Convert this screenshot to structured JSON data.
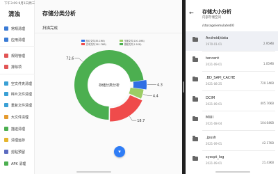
{
  "status_bar": {
    "time_date": "下午3:09 9月1日周三",
    "right": ""
  },
  "sidebar": {
    "brand": "清浊",
    "items": [
      {
        "label": "常规清理",
        "icon": "broom-icon",
        "color": "#3a7bd5"
      },
      {
        "label": "应用清理",
        "icon": "apps-icon",
        "color": "#3a7bd5"
      },
      {
        "label": "规则管理",
        "icon": "rules-icon",
        "color": "#e25555"
      },
      {
        "label": "排除项",
        "icon": "exclude-icon",
        "color": "#e25555"
      },
      {
        "label": "空文件夹清理",
        "icon": "empty-folder-icon",
        "color": "#3aa0d5"
      },
      {
        "label": "碎片文件清理",
        "icon": "fragment-icon",
        "color": "#3aa0d5"
      },
      {
        "label": "重复文件清理",
        "icon": "duplicate-icon",
        "color": "#3aa0d5"
      },
      {
        "label": "大文件清理",
        "icon": "large-file-icon",
        "color": "#e59b2f"
      },
      {
        "label": "描迹清理",
        "icon": "trace-icon",
        "color": "#4caf50"
      },
      {
        "label": "清理运存",
        "icon": "memory-icon",
        "color": "#e5b52f"
      },
      {
        "label": "剪贴预留",
        "icon": "clipboard-icon",
        "color": "#5c6bc0"
      },
      {
        "label": "APK 清理",
        "icon": "android-icon",
        "color": "#4caf50"
      }
    ]
  },
  "main": {
    "title": "存储分类分析",
    "scan_status": "扫描完成",
    "fab_icon": "filter-icon"
  },
  "chart_data": {
    "type": "pie",
    "donut": true,
    "center_label": "存储分类分析",
    "series": [
      {
        "name": "图片文件(85.1MB)",
        "value": 4.3,
        "color": "#2f6fe4"
      },
      {
        "name": "压缩文件(100.1MB)",
        "value": 4.4,
        "color": "#9ccc65"
      },
      {
        "name": "文本文件(361.7MB)",
        "value": 18.7,
        "color": "#ef4b4b"
      },
      {
        "name": "视频文件(1.5GB)",
        "value": 72.6,
        "color": "#4caf50"
      }
    ],
    "labels": [
      "4.3",
      "4.4",
      "18.7",
      "72.6"
    ]
  },
  "right_panel": {
    "title": "存储大小分析",
    "subtitle": "内部存储空间",
    "path": "/storage/emulated/0",
    "back_icon": "arrow-left-icon",
    "files": [
      {
        "name": "Android/data",
        "date": "1970-01-01",
        "size": "2.95MB"
      },
      {
        "name": "tencent",
        "date": "2021-09-01",
        "size": "1.05MB"
      },
      {
        "name": ".BD_SAPI_CACHE",
        "date": "2021-08-25",
        "size": "720.14KB"
      },
      {
        "name": "DCIM",
        "date": "2021-09-01",
        "size": "405.76KB"
      },
      {
        "name": "MIUI",
        "date": "2021-08-04",
        "size": "104.64KB"
      },
      {
        "name": ".jpush",
        "date": "2021-09-01",
        "size": "42.17KB"
      },
      {
        "name": "sysopt_log",
        "date": "2021-09-01",
        "size": "21.43KB"
      }
    ]
  }
}
